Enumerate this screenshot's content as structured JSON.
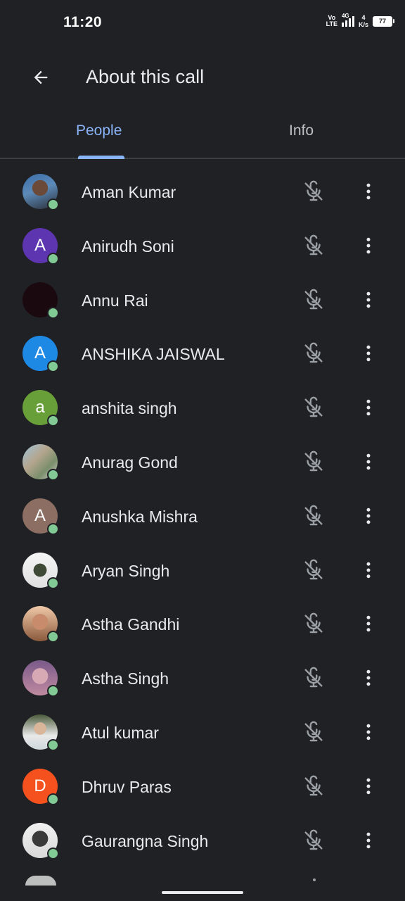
{
  "status_bar": {
    "time": "11:20",
    "volte_top": "Vo",
    "volte_bottom": "LTE",
    "network": "4G",
    "speed_value": "4",
    "speed_unit": "K/s",
    "battery": "77"
  },
  "header": {
    "back_icon": "arrow-back-icon",
    "title": "About this call"
  },
  "tabs": [
    {
      "label": "People",
      "active": true
    },
    {
      "label": "Info",
      "active": false
    }
  ],
  "colors": {
    "background": "#202124",
    "accent": "#8ab4f8",
    "presence": "#81c995"
  },
  "participants": [
    {
      "name": "Aman Kumar",
      "avatar_type": "photo",
      "mic": "mic-off-icon"
    },
    {
      "name": "Anirudh Soni",
      "avatar_type": "letter",
      "initial": "A",
      "avatar_color": "#5e35b1",
      "mic": "mic-off-icon"
    },
    {
      "name": "Annu Rai",
      "avatar_type": "photo",
      "mic": "mic-off-icon"
    },
    {
      "name": "ANSHIKA JAISWAL",
      "avatar_type": "letter",
      "initial": "A",
      "avatar_color": "#1e88e5",
      "mic": "mic-off-icon"
    },
    {
      "name": "anshita singh",
      "avatar_type": "letter",
      "initial": "a",
      "avatar_color": "#689f38",
      "mic": "mic-off-icon"
    },
    {
      "name": "Anurag Gond",
      "avatar_type": "photo",
      "mic": "mic-off-icon"
    },
    {
      "name": "Anushka Mishra",
      "avatar_type": "letter",
      "initial": "A",
      "avatar_color": "#8d6e63",
      "mic": "mic-off-icon"
    },
    {
      "name": "Aryan Singh",
      "avatar_type": "photo",
      "mic": "mic-off-icon"
    },
    {
      "name": "Astha Gandhi",
      "avatar_type": "photo",
      "mic": "mic-off-icon"
    },
    {
      "name": "Astha Singh",
      "avatar_type": "photo",
      "mic": "mic-off-icon"
    },
    {
      "name": "Atul kumar",
      "avatar_type": "photo",
      "mic": "mic-off-icon"
    },
    {
      "name": "Dhruv Paras",
      "avatar_type": "letter",
      "initial": "D",
      "avatar_color": "#f4511e",
      "mic": "mic-off-icon"
    },
    {
      "name": "Gaurangna Singh",
      "avatar_type": "photo",
      "mic": "mic-off-icon"
    }
  ]
}
